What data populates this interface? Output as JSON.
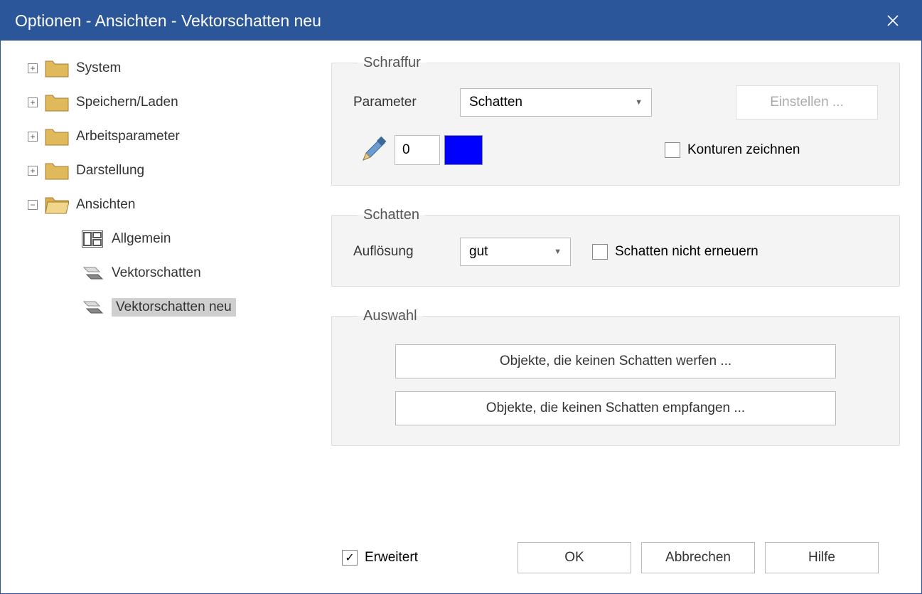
{
  "title": "Optionen - Ansichten - Vektorschatten neu",
  "tree": {
    "system": "System",
    "speichern": "Speichern/Laden",
    "arbeit": "Arbeitsparameter",
    "darstellung": "Darstellung",
    "ansichten": "Ansichten",
    "allgemein": "Allgemein",
    "vektorschatten": "Vektorschatten",
    "vektorschatten_neu": "Vektorschatten neu"
  },
  "schraffur": {
    "legend": "Schraffur",
    "parameter_label": "Parameter",
    "parameter_value": "Schatten",
    "einstellen": "Einstellen ...",
    "num_value": "0",
    "konturen": "Konturen zeichnen",
    "color": "#0000ff"
  },
  "schatten": {
    "legend": "Schatten",
    "aufl_label": "Auflösung",
    "aufl_value": "gut",
    "nicht_erneuern": "Schatten nicht erneuern"
  },
  "auswahl": {
    "legend": "Auswahl",
    "btn1": "Objekte, die keinen Schatten werfen ...",
    "btn2": "Objekte, die keinen Schatten empfangen ..."
  },
  "footer": {
    "erweitert": "Erweitert",
    "ok": "OK",
    "abbrechen": "Abbrechen",
    "hilfe": "Hilfe"
  }
}
